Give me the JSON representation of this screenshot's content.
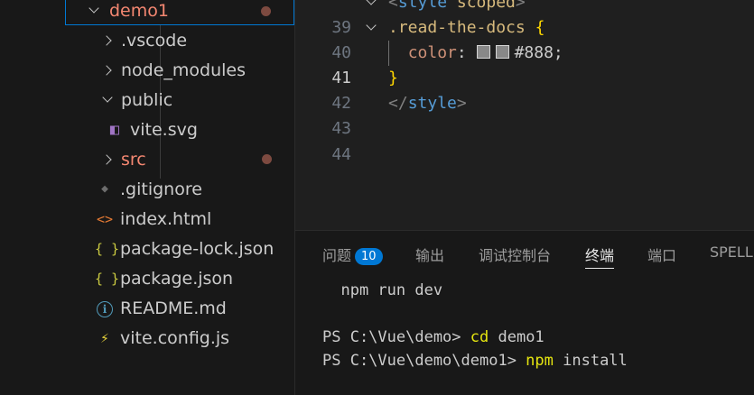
{
  "explorer": {
    "items": [
      {
        "label": "demo1",
        "kind": "folder-open",
        "modified": true
      },
      {
        "label": ".vscode",
        "kind": "folder"
      },
      {
        "label": "node_modules",
        "kind": "folder"
      },
      {
        "label": "public",
        "kind": "folder-open"
      },
      {
        "label": "vite.svg",
        "kind": "file-svg"
      },
      {
        "label": "src",
        "kind": "folder",
        "modified": true
      },
      {
        "label": ".gitignore",
        "kind": "file-git"
      },
      {
        "label": "index.html",
        "kind": "file-html"
      },
      {
        "label": "package-lock.json",
        "kind": "file-json"
      },
      {
        "label": "package.json",
        "kind": "file-json"
      },
      {
        "label": "README.md",
        "kind": "file-info"
      },
      {
        "label": "vite.config.js",
        "kind": "file-vite"
      }
    ],
    "icons": {
      "json": "{ }",
      "html": "<>",
      "info": "i",
      "git": "◆",
      "vite": "⚡",
      "svg": "◧"
    }
  },
  "editor": {
    "lines": [
      {
        "number": "39",
        "open_tag": "<",
        "tag": "style",
        "attr": "scoped",
        "close_tag": ">"
      },
      {
        "number": "40",
        "selector": ".read-the-docs",
        "brace": "{"
      },
      {
        "number": "41",
        "property": "color",
        "colon": ":",
        "value": "#888;"
      },
      {
        "number": "42",
        "brace": "}"
      },
      {
        "number": "43",
        "open_tag": "</",
        "tag": "style",
        "close_tag": ">"
      },
      {
        "number": "44"
      }
    ],
    "colors": {
      "swatch": "#888888"
    }
  },
  "panel": {
    "tabs": {
      "problems": "问题",
      "problems_count": "10",
      "output": "输出",
      "debug_console": "调试控制台",
      "terminal": "终端",
      "ports": "端口",
      "spell": "SPELL C"
    },
    "terminal": {
      "line1": "  npm run dev",
      "line2_prompt": "PS C:\\Vue\\demo> ",
      "line2_cmd": "cd",
      "line2_arg": " demo1",
      "line3_prompt": "PS C:\\Vue\\demo\\demo1> ",
      "line3_cmd": "npm",
      "line3_arg": " install"
    }
  }
}
